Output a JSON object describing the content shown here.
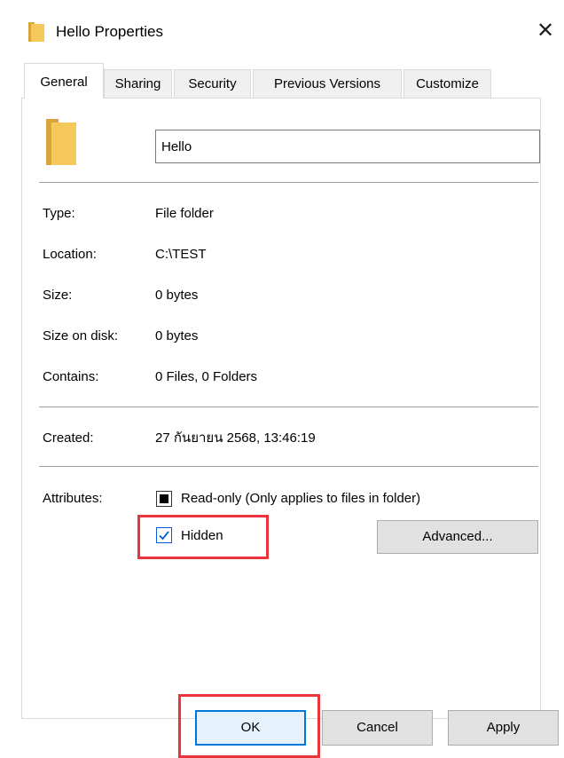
{
  "window": {
    "title": "Hello Properties",
    "close_glyph": "✕"
  },
  "tabs": [
    {
      "label": "General",
      "active": true
    },
    {
      "label": "Sharing",
      "active": false
    },
    {
      "label": "Security",
      "active": false
    },
    {
      "label": "Previous Versions",
      "active": false
    },
    {
      "label": "Customize",
      "active": false
    }
  ],
  "general": {
    "folder_name": "Hello",
    "fields": [
      {
        "label": "Type:",
        "value": "File folder"
      },
      {
        "label": "Location:",
        "value": "C:\\TEST"
      },
      {
        "label": "Size:",
        "value": "0 bytes"
      },
      {
        "label": "Size on disk:",
        "value": "0 bytes"
      },
      {
        "label": "Contains:",
        "value": "0 Files, 0 Folders"
      }
    ],
    "created": {
      "label": "Created:",
      "value": "27 กันยายน 2568, 13:46:19"
    },
    "attributes": {
      "label": "Attributes:",
      "readonly_label": "Read-only (Only applies to files in folder)",
      "readonly_state": "indeterminate",
      "hidden_label": "Hidden",
      "hidden_checked": true,
      "advanced_button": "Advanced..."
    }
  },
  "footer": {
    "ok": "OK",
    "cancel": "Cancel",
    "apply": "Apply"
  },
  "icons": {
    "folder": "folder-icon",
    "check": "checkmark-icon"
  },
  "colors": {
    "accent": "#0078d7",
    "highlight": "#e8343a",
    "folder": "#f4c85a"
  }
}
